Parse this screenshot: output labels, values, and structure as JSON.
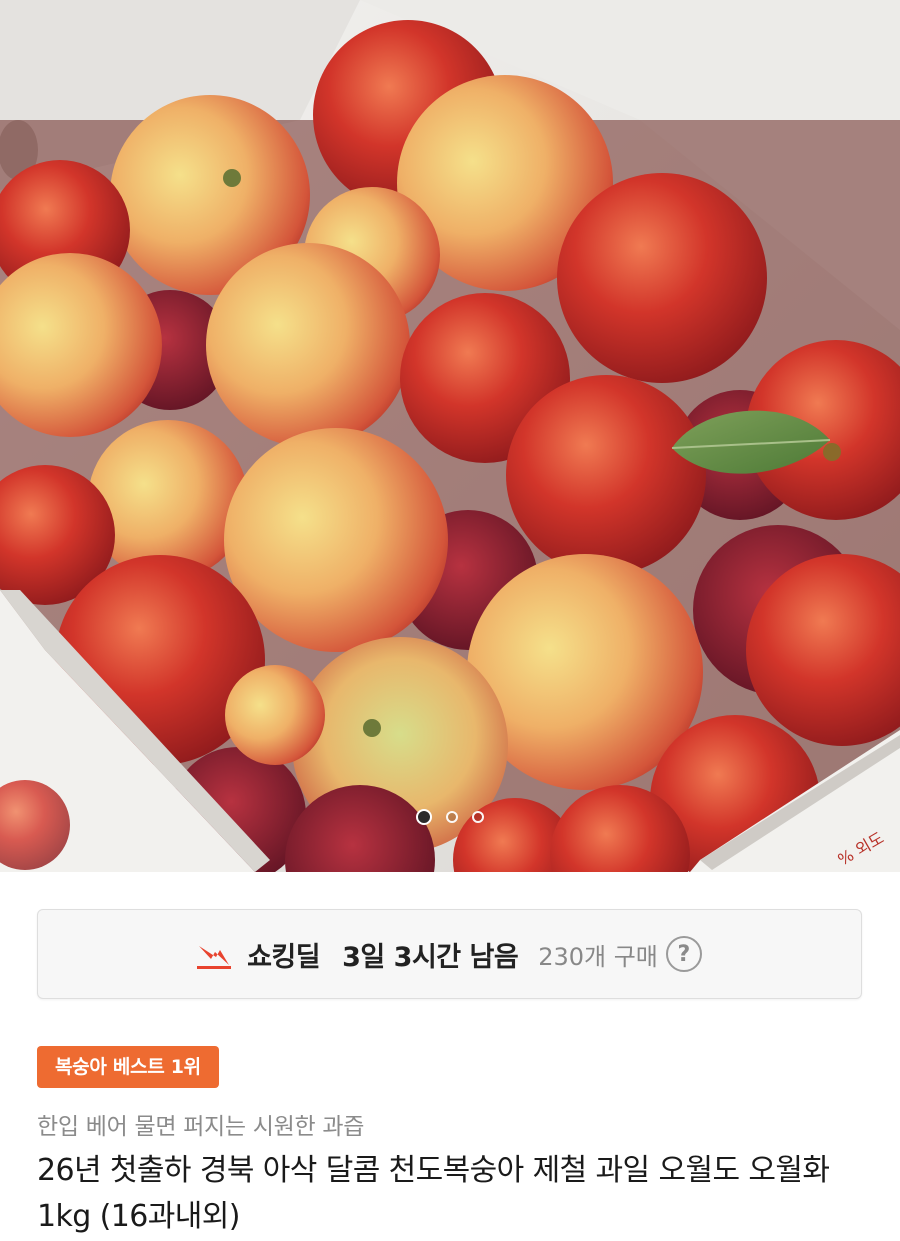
{
  "gallery": {
    "image_alt": "peach-box-photo",
    "box_print": "% 외도",
    "dots": [
      {
        "state": "active"
      },
      {
        "state": "inactive"
      },
      {
        "state": "inactive"
      }
    ]
  },
  "deal": {
    "icon": "lightning-bolt-icon",
    "title": "쇼킹딜",
    "remaining": "3일 3시간 남음",
    "purchase_count": "230개 구매",
    "help_symbol": "?"
  },
  "product": {
    "badge": "복숭아 베스트 1위",
    "subtitle": "한입 베어 물면 퍼지는 시원한 과즙",
    "title": "26년 첫출하 경북 아삭 달콤 천도복숭아 제철 과일 오월도 오월화 1kg (16과내외)"
  },
  "colors": {
    "accent": "#ee6b31",
    "bolt": "#e8432e",
    "text_primary": "#1a1a1a",
    "text_secondary": "#8b8b8b"
  }
}
